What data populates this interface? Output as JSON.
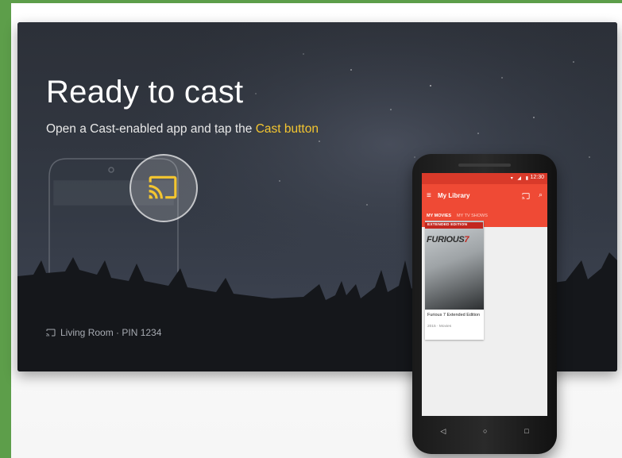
{
  "tv": {
    "title": "Ready to cast",
    "subtitle_prefix": "Open a Cast-enabled app and tap the ",
    "subtitle_highlight": "Cast button",
    "status": "Living Room · PIN 1234"
  },
  "phone": {
    "status_time": "12:30",
    "app_title": "My Library",
    "tabs": [
      "MY MOVIES",
      "MY TV SHOWS"
    ],
    "card": {
      "badge": "EXTENDED EDITION",
      "poster_logo_prefix": "FURIOUS",
      "poster_logo_number": "7",
      "title": "Furious 7 Extended Edition",
      "subtitle": "2015 · Movies"
    },
    "nav": [
      "◁",
      "○",
      "□"
    ]
  },
  "colors": {
    "accent": "#f4c630",
    "frame": "#5d9e4a",
    "app_red": "#ef4a35"
  }
}
